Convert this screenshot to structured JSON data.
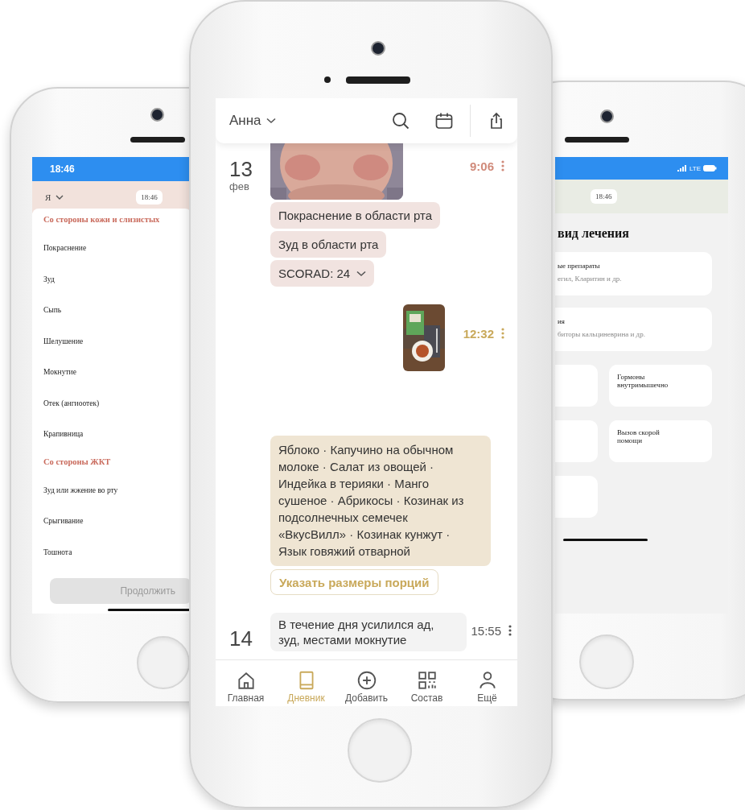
{
  "left_phone": {
    "status_time": "18:46",
    "profile": "Я",
    "time_chip": "18:46",
    "sections": [
      {
        "title": "Со стороны кожи и слизистых",
        "items": [
          "Покраснение",
          "Зуд",
          "Сыпь",
          "Шелушение",
          "Мокнутие",
          "Отек (ангиоотек)",
          "Крапивница"
        ]
      },
      {
        "title": "Со стороны ЖКТ",
        "items": [
          "Зуд или жжение во рту",
          "Срыгивание",
          "Тошнота"
        ]
      }
    ],
    "continue_button": {
      "label": "Продолжить",
      "disabled": true
    }
  },
  "center_phone": {
    "header": {
      "profile": "Анна"
    },
    "days": [
      {
        "day": "13",
        "month": "фев",
        "entries": [
          {
            "kind": "symptoms",
            "time": "9:06",
            "tags": [
              "Покраснение в области рта",
              "Зуд в области рта"
            ],
            "scorad": "SCORAD: 24"
          },
          {
            "kind": "meal",
            "time": "12:32",
            "foods": "Яблоко · Капучино на обычном молоке · Салат из овощей · Индейка в терияки · Манго сушеное · Абрикосы · Козинак из подсолнечных семечек «ВкусВилл» · Козинак кунжут · Язык говяжий отварной",
            "portion_button": "Указать размеры порций"
          }
        ]
      },
      {
        "day": "14",
        "entries": [
          {
            "kind": "note",
            "time": "15:55",
            "text": "В течение дня усилился ад, зуд, местами мокнутие"
          }
        ]
      }
    ],
    "tabs": [
      {
        "label": "Главная",
        "kind": "home",
        "selected": false
      },
      {
        "label": "Дневник",
        "kind": "book",
        "selected": true
      },
      {
        "label": "Добавить",
        "kind": "plus",
        "selected": false
      },
      {
        "label": "Состав",
        "kind": "grid",
        "selected": false
      },
      {
        "label": "Ещё",
        "kind": "person",
        "selected": false
      }
    ]
  },
  "right_phone": {
    "network": "LTE",
    "time_chip": "18:46",
    "title": "вид лечения",
    "wide_cards": [
      {
        "title": "ые препараты",
        "subtitle": "егил, Кларитин и др."
      },
      {
        "title": "ия",
        "subtitle": "биторы кальциневрина и др."
      }
    ],
    "tiles": [
      "Гормоны внутримышечно",
      "Вызов скорой помощи"
    ]
  }
}
